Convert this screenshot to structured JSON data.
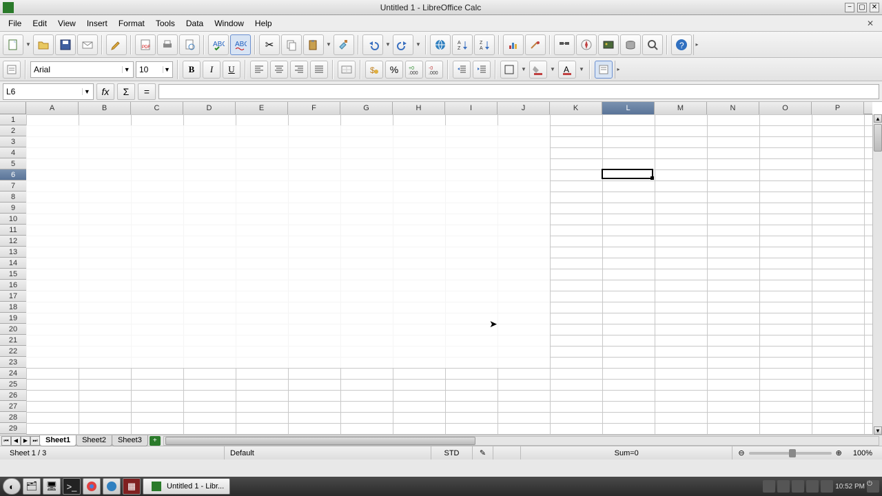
{
  "window": {
    "title": "Untitled 1 - LibreOffice Calc",
    "min": "−",
    "max": "▢",
    "close": "✕"
  },
  "menu": {
    "file": "File",
    "edit": "Edit",
    "view": "View",
    "insert": "Insert",
    "format": "Format",
    "tools": "Tools",
    "data": "Data",
    "window": "Window",
    "help": "Help"
  },
  "toolbar": {
    "font_name": "Arial",
    "font_size": "10",
    "bold": "B",
    "italic": "I",
    "underline": "U",
    "percent": "%",
    "equals": "="
  },
  "formula_bar": {
    "cell_ref": "L6",
    "fx": "fx",
    "sum": "Σ",
    "eq": "=",
    "value": ""
  },
  "columns": [
    "A",
    "B",
    "C",
    "D",
    "E",
    "F",
    "G",
    "H",
    "I",
    "J",
    "K",
    "L",
    "M",
    "N",
    "O",
    "P"
  ],
  "row_count": 30,
  "active": {
    "col": "L",
    "row": 6
  },
  "sheets": {
    "tabs": [
      "Sheet1",
      "Sheet2",
      "Sheet3"
    ],
    "active": 0
  },
  "status": {
    "sheet": "Sheet 1 / 3",
    "style": "Default",
    "mode": "STD",
    "sum": "Sum=0",
    "zoom": "100%"
  },
  "taskbar": {
    "active_window": "Untitled 1 - Libr...",
    "clock": "10:52 PM"
  }
}
